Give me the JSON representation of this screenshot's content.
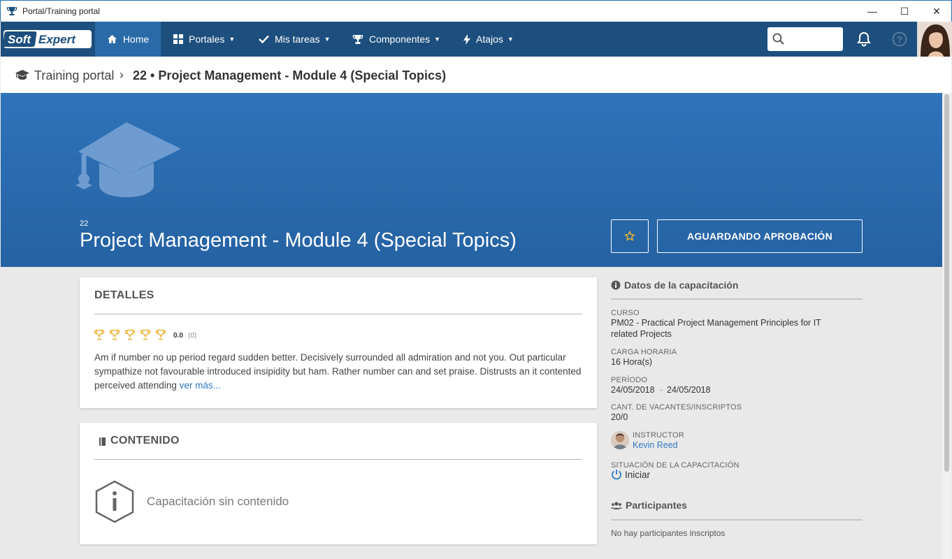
{
  "window": {
    "title": "Portal/Training portal",
    "min": "—",
    "max": "☐",
    "close": "✕"
  },
  "nav": {
    "logo_soft": "Soft",
    "logo_expert": "Expert",
    "home": "Home",
    "portales": "Portales",
    "mis_tareas": "Mis tareas",
    "componentes": "Componentes",
    "atajos": "Atajos",
    "search_placeholder": "",
    "colors": {
      "navbar": "#1c4f7d",
      "active": "#2b6aa8"
    }
  },
  "breadcrumb": {
    "root": "Training portal",
    "separator": "›",
    "current": "22 • Project Management - Module 4 (Special Topics)"
  },
  "hero": {
    "code": "22",
    "title": "Project Management - Module 4 (Special Topics)",
    "status_button": "AGUARDANDO APROBACIÓN",
    "favorite_icon": "star-outline-icon",
    "colors": {
      "background": "#2f73b9",
      "star": "#f0b429"
    }
  },
  "details": {
    "title": "DETALLES",
    "rating_value": "0.0",
    "rating_count": "(0)",
    "trophy_count": 5,
    "description": "Am if number no up period regard sudden better. Decisively surrounded all admiration and not you. Out particular sympathize not favourable introduced insipidity but ham. Rather number can and set praise. Distrusts an it contented perceived attending",
    "more_link": "ver más..."
  },
  "content": {
    "title": "CONTENIDO",
    "empty_message": "Capacitación sin contenido"
  },
  "side": {
    "datos_title": "Datos de la capacitación",
    "curso_label": "CURSO",
    "curso_value": "PM02 - Practical Project Management Principles for IT related Projects",
    "carga_label": "CARGA HORARIA",
    "carga_value": "16 Hora(s)",
    "periodo_label": "PERÍODO",
    "periodo_start": "24/05/2018",
    "periodo_sep": "-",
    "periodo_end": "24/05/2018",
    "vacantes_label": "CANT. DE VACANTES/INSCRIPTOS",
    "vacantes_value": "20/0",
    "instructor_label": "INSTRUCTOR",
    "instructor_name": "Kevin Reed",
    "situacion_label": "SITUACIÓN DE LA CAPACITACIÓN",
    "situacion_value": "Iniciar",
    "participantes_title": "Participantes",
    "participantes_empty": "No hay participantes inscriptos"
  }
}
